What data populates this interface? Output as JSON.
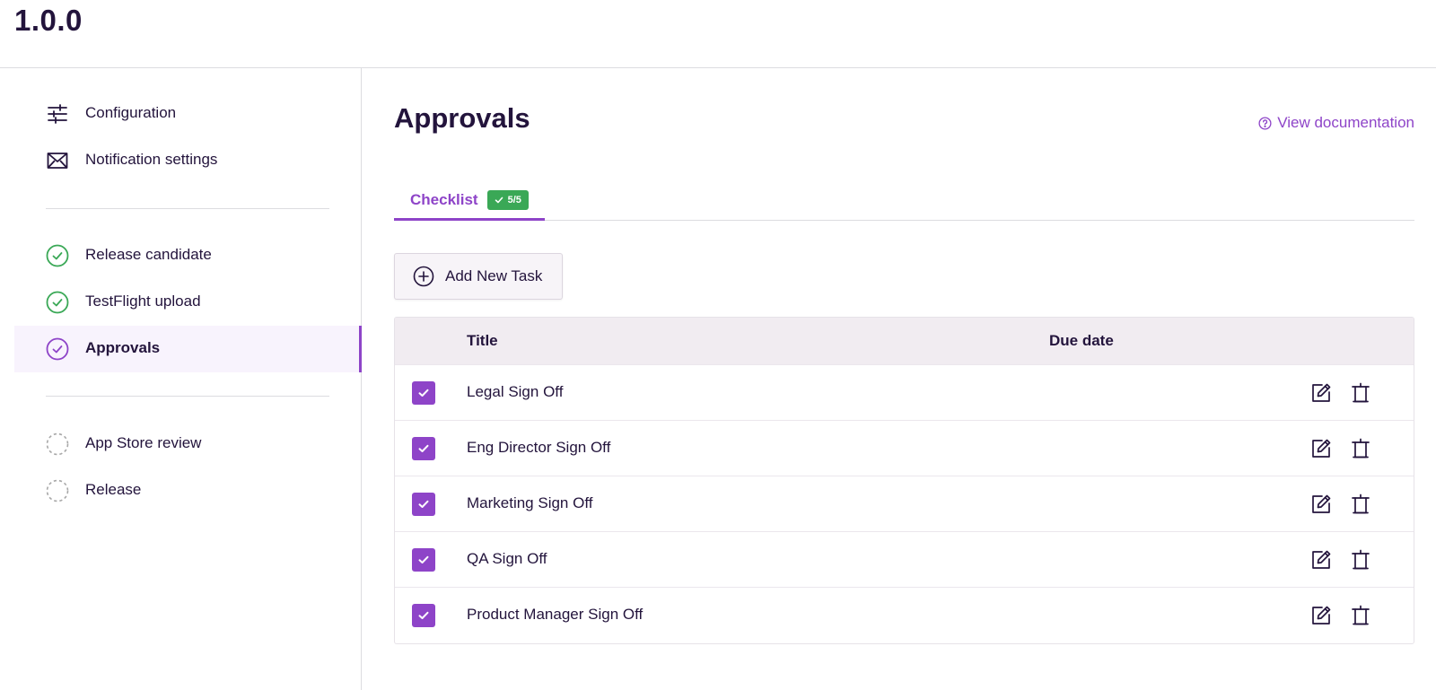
{
  "header": {
    "version": "1.0.0"
  },
  "sidebar": {
    "config_items": [
      {
        "label": "Configuration",
        "icon": "sliders-icon"
      },
      {
        "label": "Notification settings",
        "icon": "envelope-icon"
      }
    ],
    "steps": [
      {
        "label": "Release candidate",
        "status": "complete",
        "icon": "check-circle-icon"
      },
      {
        "label": "TestFlight upload",
        "status": "complete",
        "icon": "check-circle-icon"
      },
      {
        "label": "Approvals",
        "status": "active",
        "icon": "check-circle-icon"
      }
    ],
    "pending_steps": [
      {
        "label": "App Store review",
        "status": "pending",
        "icon": "dashed-circle-icon"
      },
      {
        "label": "Release",
        "status": "pending",
        "icon": "dashed-circle-icon"
      }
    ]
  },
  "main": {
    "title": "Approvals",
    "doc_link": "View documentation",
    "tabs": [
      {
        "label": "Checklist",
        "badge": "5/5"
      }
    ],
    "add_button": "Add New Task",
    "table": {
      "columns": [
        "Title",
        "Due date"
      ],
      "rows": [
        {
          "title": "Legal Sign Off",
          "checked": true
        },
        {
          "title": "Eng Director Sign Off",
          "checked": true
        },
        {
          "title": "Marketing Sign Off",
          "checked": true
        },
        {
          "title": "QA Sign Off",
          "checked": true
        },
        {
          "title": "Product Manager Sign Off",
          "checked": true
        }
      ]
    }
  },
  "colors": {
    "accent": "#8e44c8",
    "success": "#3aa856",
    "text": "#23143c",
    "pending": "#a8a8a8"
  }
}
